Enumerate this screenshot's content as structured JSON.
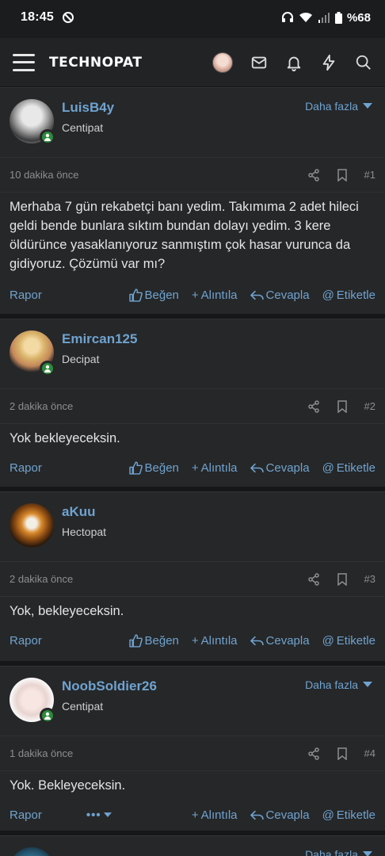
{
  "status": {
    "time": "18:45",
    "battery": "%68"
  },
  "header": {
    "logo": "TECHNOPAT"
  },
  "posts": [
    {
      "user": "LuisB4y",
      "rank": "Centipat",
      "more": "Daha fazla",
      "time": "10 dakika önce",
      "num": "#1",
      "body": "Merhaba 7 gün rekabetçi banı yedim. Takımıma 2 adet hileci geldi bende bunlara sıktım bundan dolayı yedim. 3 kere öldürünce yasaklanıyoruz sanmıştım çok hasar vurunca da gidiyoruz. Çözümü var mı?",
      "report": "Rapor",
      "like": "Beğen",
      "quote": "Alıntıla",
      "reply": "Cevapla",
      "tag": "Etiketle"
    },
    {
      "user": "Emircan125",
      "rank": "Decipat",
      "time": "2 dakika önce",
      "num": "#2",
      "body": "Yok bekleyeceksin.",
      "report": "Rapor",
      "like": "Beğen",
      "quote": "Alıntıla",
      "reply": "Cevapla",
      "tag": "Etiketle"
    },
    {
      "user": "aKuu",
      "rank": "Hectopat",
      "time": "2 dakika önce",
      "num": "#3",
      "body": "Yok, bekleyeceksin.",
      "report": "Rapor",
      "like": "Beğen",
      "quote": "Alıntıla",
      "reply": "Cevapla",
      "tag": "Etiketle"
    },
    {
      "user": "NoobSoldier26",
      "rank": "Centipat",
      "more": "Daha fazla",
      "time": "1 dakika önce",
      "num": "#4",
      "body": "Yok. Bekleyeceksin.",
      "report": "Rapor",
      "dots": "•••",
      "quote": "Alıntıla",
      "reply": "Cevapla",
      "tag": "Etiketle"
    },
    {
      "more": "Daha fazla"
    }
  ],
  "colors": {
    "accent": "#6fa3cf",
    "online": "#2d8a3b",
    "background": "#1b1c1e",
    "card": "#262729"
  },
  "icons": [
    "menu-icon",
    "mail-icon",
    "bell-icon",
    "bolt-icon",
    "search-icon",
    "share-icon",
    "bookmark-icon",
    "thumb-up-icon",
    "plus-icon",
    "reply-icon",
    "at-icon",
    "chevron-down-icon"
  ]
}
